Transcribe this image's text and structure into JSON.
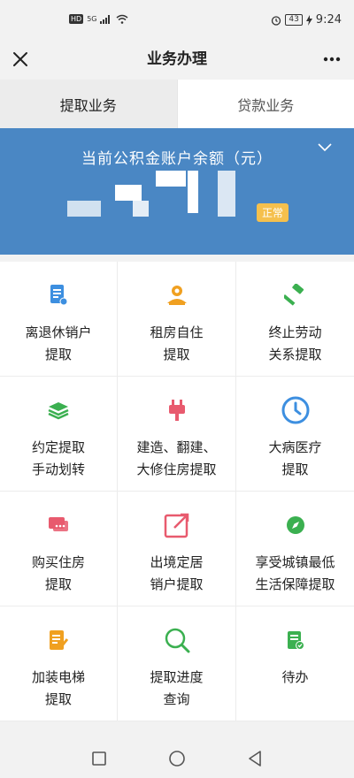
{
  "status_bar": {
    "hd": "HD",
    "signal": "5G",
    "battery": "43",
    "time": "9:24"
  },
  "title_bar": {
    "title": "业务办理"
  },
  "tabs": [
    {
      "label": "提取业务",
      "active": true
    },
    {
      "label": "贷款业务",
      "active": false
    }
  ],
  "balance": {
    "label": "当前公积金账户余额（元）",
    "status": "正常"
  },
  "services": [
    {
      "line1": "离退休销户",
      "line2": "提取",
      "icon": "document-icon",
      "color": "#3d8fe0"
    },
    {
      "line1": "租房自住",
      "line2": "提取",
      "icon": "house-person-icon",
      "color": "#f0a020"
    },
    {
      "line1": "终止劳动",
      "line2": "关系提取",
      "icon": "hammer-icon",
      "color": "#3bb050"
    },
    {
      "line1": "约定提取",
      "line2": "手动划转",
      "icon": "layers-icon",
      "color": "#3bb050"
    },
    {
      "line1": "建造、翻建、",
      "line2": "大修住房提取",
      "icon": "plug-icon",
      "color": "#e85a6e"
    },
    {
      "line1": "大病医疗",
      "line2": "提取",
      "icon": "clock-icon",
      "color": "#3d8fe0"
    },
    {
      "line1": "购买住房",
      "line2": "提取",
      "icon": "chat-icon",
      "color": "#e85a6e"
    },
    {
      "line1": "出境定居",
      "line2": "销户提取",
      "icon": "external-link-icon",
      "color": "#e85a6e"
    },
    {
      "line1": "享受城镇最低",
      "line2": "生活保障提取",
      "icon": "compass-icon",
      "color": "#3bb050"
    },
    {
      "line1": "加装电梯",
      "line2": "提取",
      "icon": "edit-document-icon",
      "color": "#f0a020"
    },
    {
      "line1": "提取进度",
      "line2": "查询",
      "icon": "search-icon",
      "color": "#3bb050"
    },
    {
      "line1": "待办",
      "line2": "",
      "icon": "todo-document-icon",
      "color": "#3bb050"
    }
  ]
}
